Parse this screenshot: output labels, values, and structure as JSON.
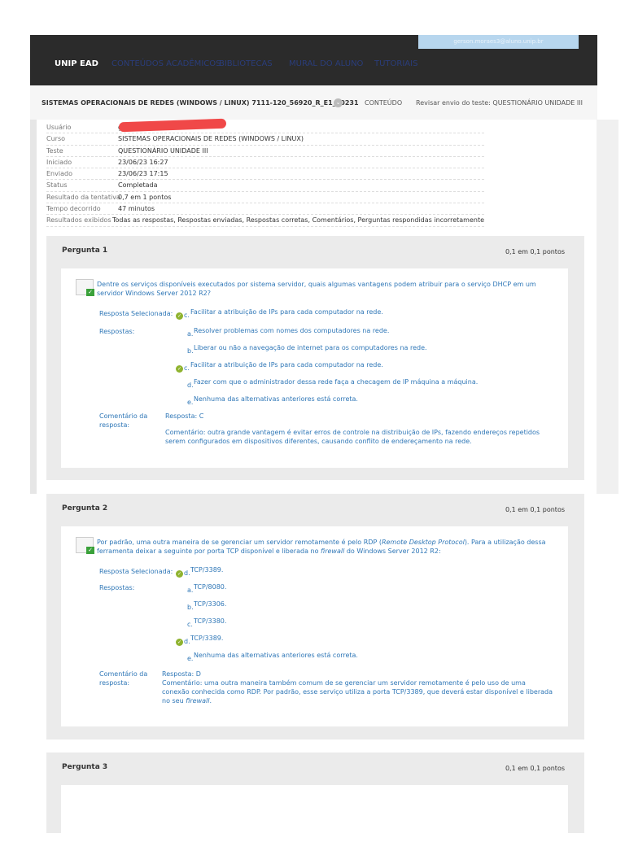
{
  "header": {
    "brand": "UNIP EAD",
    "nav": [
      "CONTEÚDOS ACADÊMICOS",
      "BIBLIOTECAS",
      "MURAL DO ALUNO",
      "TUTORIAIS"
    ],
    "user_email": "gerson.moraes3@aluno.unip.br"
  },
  "breadcrumb": {
    "course": "SISTEMAS OPERACIONAIS DE REDES (WINDOWS / LINUX) 7111-120_56920_R_E1_20231",
    "content": "CONTEÚDO",
    "page": "Revisar envio do teste: QUESTIONÁRIO UNIDADE III"
  },
  "info": [
    {
      "k": "Usuário",
      "v": "ge"
    },
    {
      "k": "Curso",
      "v": "SISTEMAS OPERACIONAIS DE REDES (WINDOWS / LINUX)"
    },
    {
      "k": "Teste",
      "v": "QUESTIONÁRIO UNIDADE III"
    },
    {
      "k": "Iniciado",
      "v": "23/06/23 16:27"
    },
    {
      "k": "Enviado",
      "v": "23/06/23 17:15"
    },
    {
      "k": "Status",
      "v": "Completada"
    },
    {
      "k": "Resultado da tentativa",
      "v": "0,7 em 1 pontos"
    },
    {
      "k": "Tempo decorrido",
      "v": "47 minutos"
    },
    {
      "k": "Resultados exibidos",
      "v": "Todas as respostas, Respostas enviadas, Respostas corretas, Comentários, Perguntas respondidas incorretamente"
    }
  ],
  "labels": {
    "selected": "Resposta Selecionada:",
    "answers": "Respostas:",
    "comment1": "Comentário da",
    "comment2": "resposta:"
  },
  "questions": [
    {
      "title": "Pergunta 1",
      "points": "0,1 em 0,1 pontos",
      "text": "Dentre os serviços disponíveis executados por sistema servidor, quais algumas vantagens podem atribuir para o serviço DHCP em um servidor Windows Server 2012 R2?",
      "selected": {
        "letter": "c.",
        "text": "Facilitar a atribuição de IPs para cada computador na rede."
      },
      "options": [
        {
          "letter": "a.",
          "text": "Resolver problemas com nomes dos computadores na rede."
        },
        {
          "letter": "b.",
          "text": "Liberar ou não a navegação de internet para os computadores na rede."
        },
        {
          "letter": "c.",
          "text": "Facilitar a atribuição de IPs para cada computador na rede."
        },
        {
          "letter": "d.",
          "text": "Fazer com que o administrador dessa rede faça a checagem de IP máquina a máquina."
        },
        {
          "letter": "e.",
          "text": "Nenhuma das alternativas anteriores está correta."
        }
      ],
      "answer": "Resposta: C",
      "comment": "Comentário: outra grande vantagem é evitar erros de controle na distribuição de IPs, fazendo endereços repetidos serem configurados em dispositivos diferentes, causando conflito de endereçamento na rede."
    },
    {
      "title": "Pergunta 2",
      "points": "0,1 em 0,1 pontos",
      "text_a": "Por padrão, uma outra maneira de se gerenciar um servidor remotamente é pelo RDP (",
      "text_i1": "Remote Desktop Protocol",
      "text_b": "). Para a utilização dessa ferramenta deixar a seguinte por porta TCP disponível e liberada no ",
      "text_i2": "firewall",
      "text_c": " do Windows Server 2012 R2:",
      "selected": {
        "letter": "d.",
        "text": "TCP/3389."
      },
      "options": [
        {
          "letter": "a.",
          "text": "TCP/8080."
        },
        {
          "letter": "b.",
          "text": "TCP/3306."
        },
        {
          "letter": "c.",
          "text": "TCP/3380."
        },
        {
          "letter": "d.",
          "text": "TCP/3389."
        },
        {
          "letter": "e.",
          "text": "Nenhuma das alternativas anteriores está correta."
        }
      ],
      "answer": "Resposta: D",
      "comment_a": "Comentário: uma outra maneira também comum de se gerenciar um servidor remotamente é pelo uso de uma conexão conhecida como RDP. Por padrão, esse serviço utiliza a porta TCP/3389, que deverá estar disponível e liberada no seu ",
      "comment_i": "firewall",
      "comment_b": "."
    },
    {
      "title": "Pergunta 3",
      "points": "0,1 em 0,1 pontos"
    }
  ]
}
